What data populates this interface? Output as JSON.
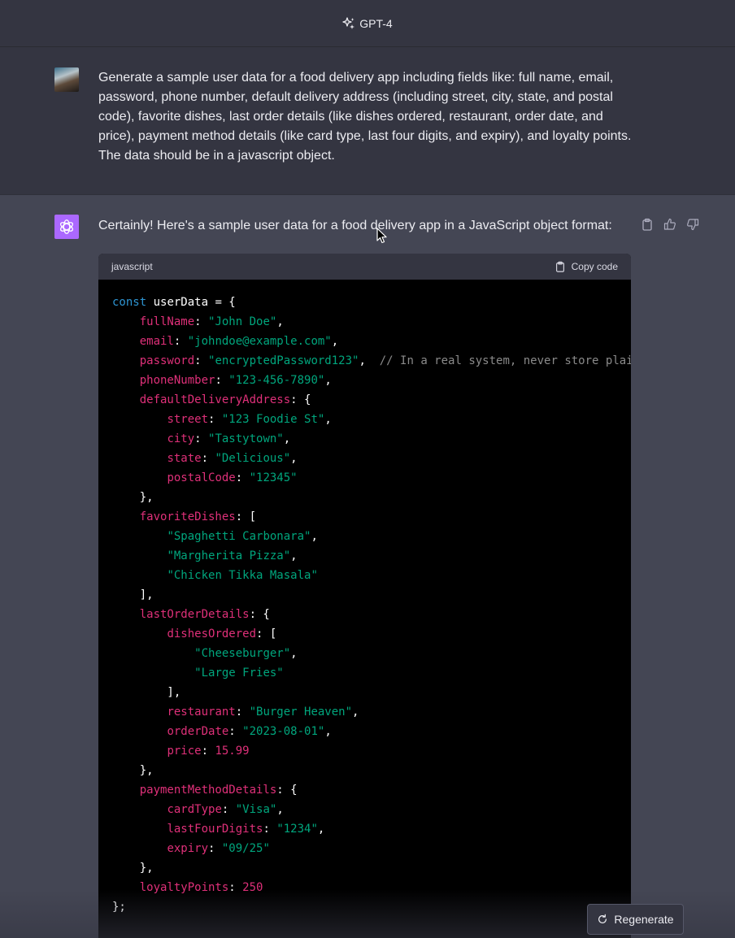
{
  "header": {
    "model_label": "GPT-4"
  },
  "user_message": {
    "text": "Generate a sample user data for a food delivery app including fields like: full name, email, password, phone number, default delivery address (including street, city, state, and postal code), favorite dishes, last order details (like dishes ordered, restaurant, order date, and price), payment method details (like card type, last four digits, and expiry), and loyalty points. The data should be in a javascript object."
  },
  "assistant_message": {
    "intro": "Certainly! Here's a sample user data for a food delivery app in a JavaScript object format:",
    "code_language": "javascript",
    "copy_label": "Copy code",
    "code_lines": [
      [
        {
          "t": "kw",
          "v": "const"
        },
        {
          "t": "p",
          "v": " userData = {"
        }
      ],
      [
        {
          "t": "p",
          "v": "    "
        },
        {
          "t": "key",
          "v": "fullName"
        },
        {
          "t": "p",
          "v": ": "
        },
        {
          "t": "str",
          "v": "\"John Doe\""
        },
        {
          "t": "p",
          "v": ","
        }
      ],
      [
        {
          "t": "p",
          "v": "    "
        },
        {
          "t": "key",
          "v": "email"
        },
        {
          "t": "p",
          "v": ": "
        },
        {
          "t": "str",
          "v": "\"johndoe@example.com\""
        },
        {
          "t": "p",
          "v": ","
        }
      ],
      [
        {
          "t": "p",
          "v": "    "
        },
        {
          "t": "key",
          "v": "password"
        },
        {
          "t": "p",
          "v": ": "
        },
        {
          "t": "str",
          "v": "\"encryptedPassword123\""
        },
        {
          "t": "p",
          "v": ",  "
        },
        {
          "t": "cmt",
          "v": "// In a real system, never store plai"
        }
      ],
      [
        {
          "t": "p",
          "v": "    "
        },
        {
          "t": "key",
          "v": "phoneNumber"
        },
        {
          "t": "p",
          "v": ": "
        },
        {
          "t": "str",
          "v": "\"123-456-7890\""
        },
        {
          "t": "p",
          "v": ","
        }
      ],
      [
        {
          "t": "p",
          "v": "    "
        },
        {
          "t": "key",
          "v": "defaultDeliveryAddress"
        },
        {
          "t": "p",
          "v": ": {"
        }
      ],
      [
        {
          "t": "p",
          "v": "        "
        },
        {
          "t": "key",
          "v": "street"
        },
        {
          "t": "p",
          "v": ": "
        },
        {
          "t": "str",
          "v": "\"123 Foodie St\""
        },
        {
          "t": "p",
          "v": ","
        }
      ],
      [
        {
          "t": "p",
          "v": "        "
        },
        {
          "t": "key",
          "v": "city"
        },
        {
          "t": "p",
          "v": ": "
        },
        {
          "t": "str",
          "v": "\"Tastytown\""
        },
        {
          "t": "p",
          "v": ","
        }
      ],
      [
        {
          "t": "p",
          "v": "        "
        },
        {
          "t": "key",
          "v": "state"
        },
        {
          "t": "p",
          "v": ": "
        },
        {
          "t": "str",
          "v": "\"Delicious\""
        },
        {
          "t": "p",
          "v": ","
        }
      ],
      [
        {
          "t": "p",
          "v": "        "
        },
        {
          "t": "key",
          "v": "postalCode"
        },
        {
          "t": "p",
          "v": ": "
        },
        {
          "t": "str",
          "v": "\"12345\""
        }
      ],
      [
        {
          "t": "p",
          "v": "    },"
        }
      ],
      [
        {
          "t": "p",
          "v": "    "
        },
        {
          "t": "key",
          "v": "favoriteDishes"
        },
        {
          "t": "p",
          "v": ": ["
        }
      ],
      [
        {
          "t": "p",
          "v": "        "
        },
        {
          "t": "str",
          "v": "\"Spaghetti Carbonara\""
        },
        {
          "t": "p",
          "v": ","
        }
      ],
      [
        {
          "t": "p",
          "v": "        "
        },
        {
          "t": "str",
          "v": "\"Margherita Pizza\""
        },
        {
          "t": "p",
          "v": ","
        }
      ],
      [
        {
          "t": "p",
          "v": "        "
        },
        {
          "t": "str",
          "v": "\"Chicken Tikka Masala\""
        }
      ],
      [
        {
          "t": "p",
          "v": "    ],"
        }
      ],
      [
        {
          "t": "p",
          "v": "    "
        },
        {
          "t": "key",
          "v": "lastOrderDetails"
        },
        {
          "t": "p",
          "v": ": {"
        }
      ],
      [
        {
          "t": "p",
          "v": "        "
        },
        {
          "t": "key",
          "v": "dishesOrdered"
        },
        {
          "t": "p",
          "v": ": ["
        }
      ],
      [
        {
          "t": "p",
          "v": "            "
        },
        {
          "t": "str",
          "v": "\"Cheeseburger\""
        },
        {
          "t": "p",
          "v": ","
        }
      ],
      [
        {
          "t": "p",
          "v": "            "
        },
        {
          "t": "str",
          "v": "\"Large Fries\""
        }
      ],
      [
        {
          "t": "p",
          "v": "        ],"
        }
      ],
      [
        {
          "t": "p",
          "v": "        "
        },
        {
          "t": "key",
          "v": "restaurant"
        },
        {
          "t": "p",
          "v": ": "
        },
        {
          "t": "str",
          "v": "\"Burger Heaven\""
        },
        {
          "t": "p",
          "v": ","
        }
      ],
      [
        {
          "t": "p",
          "v": "        "
        },
        {
          "t": "key",
          "v": "orderDate"
        },
        {
          "t": "p",
          "v": ": "
        },
        {
          "t": "str",
          "v": "\"2023-08-01\""
        },
        {
          "t": "p",
          "v": ","
        }
      ],
      [
        {
          "t": "p",
          "v": "        "
        },
        {
          "t": "key",
          "v": "price"
        },
        {
          "t": "p",
          "v": ": "
        },
        {
          "t": "num",
          "v": "15.99"
        }
      ],
      [
        {
          "t": "p",
          "v": "    },"
        }
      ],
      [
        {
          "t": "p",
          "v": "    "
        },
        {
          "t": "key",
          "v": "paymentMethodDetails"
        },
        {
          "t": "p",
          "v": ": {"
        }
      ],
      [
        {
          "t": "p",
          "v": "        "
        },
        {
          "t": "key",
          "v": "cardType"
        },
        {
          "t": "p",
          "v": ": "
        },
        {
          "t": "str",
          "v": "\"Visa\""
        },
        {
          "t": "p",
          "v": ","
        }
      ],
      [
        {
          "t": "p",
          "v": "        "
        },
        {
          "t": "key",
          "v": "lastFourDigits"
        },
        {
          "t": "p",
          "v": ": "
        },
        {
          "t": "str",
          "v": "\"1234\""
        },
        {
          "t": "p",
          "v": ","
        }
      ],
      [
        {
          "t": "p",
          "v": "        "
        },
        {
          "t": "key",
          "v": "expiry"
        },
        {
          "t": "p",
          "v": ": "
        },
        {
          "t": "str",
          "v": "\"09/25\""
        }
      ],
      [
        {
          "t": "p",
          "v": "    },"
        }
      ],
      [
        {
          "t": "p",
          "v": "    "
        },
        {
          "t": "key",
          "v": "loyaltyPoints"
        },
        {
          "t": "p",
          "v": ": "
        },
        {
          "t": "num",
          "v": "250"
        }
      ],
      [
        {
          "t": "p",
          "v": "};"
        }
      ]
    ]
  },
  "footer": {
    "regenerate_label": "Regenerate"
  },
  "colors": {
    "background": "#444654",
    "user_row": "#343541",
    "assistant_avatar": "#ab68ff",
    "code_keyword": "#2e95d3",
    "code_property": "#df3079",
    "code_string": "#00a67d",
    "code_comment": "#8a8a8a"
  },
  "icons": [
    "sparkle-icon",
    "openai-logo-icon",
    "clipboard-icon",
    "thumbs-up-icon",
    "thumbs-down-icon",
    "copy-icon",
    "refresh-icon",
    "mouse-cursor-icon"
  ]
}
